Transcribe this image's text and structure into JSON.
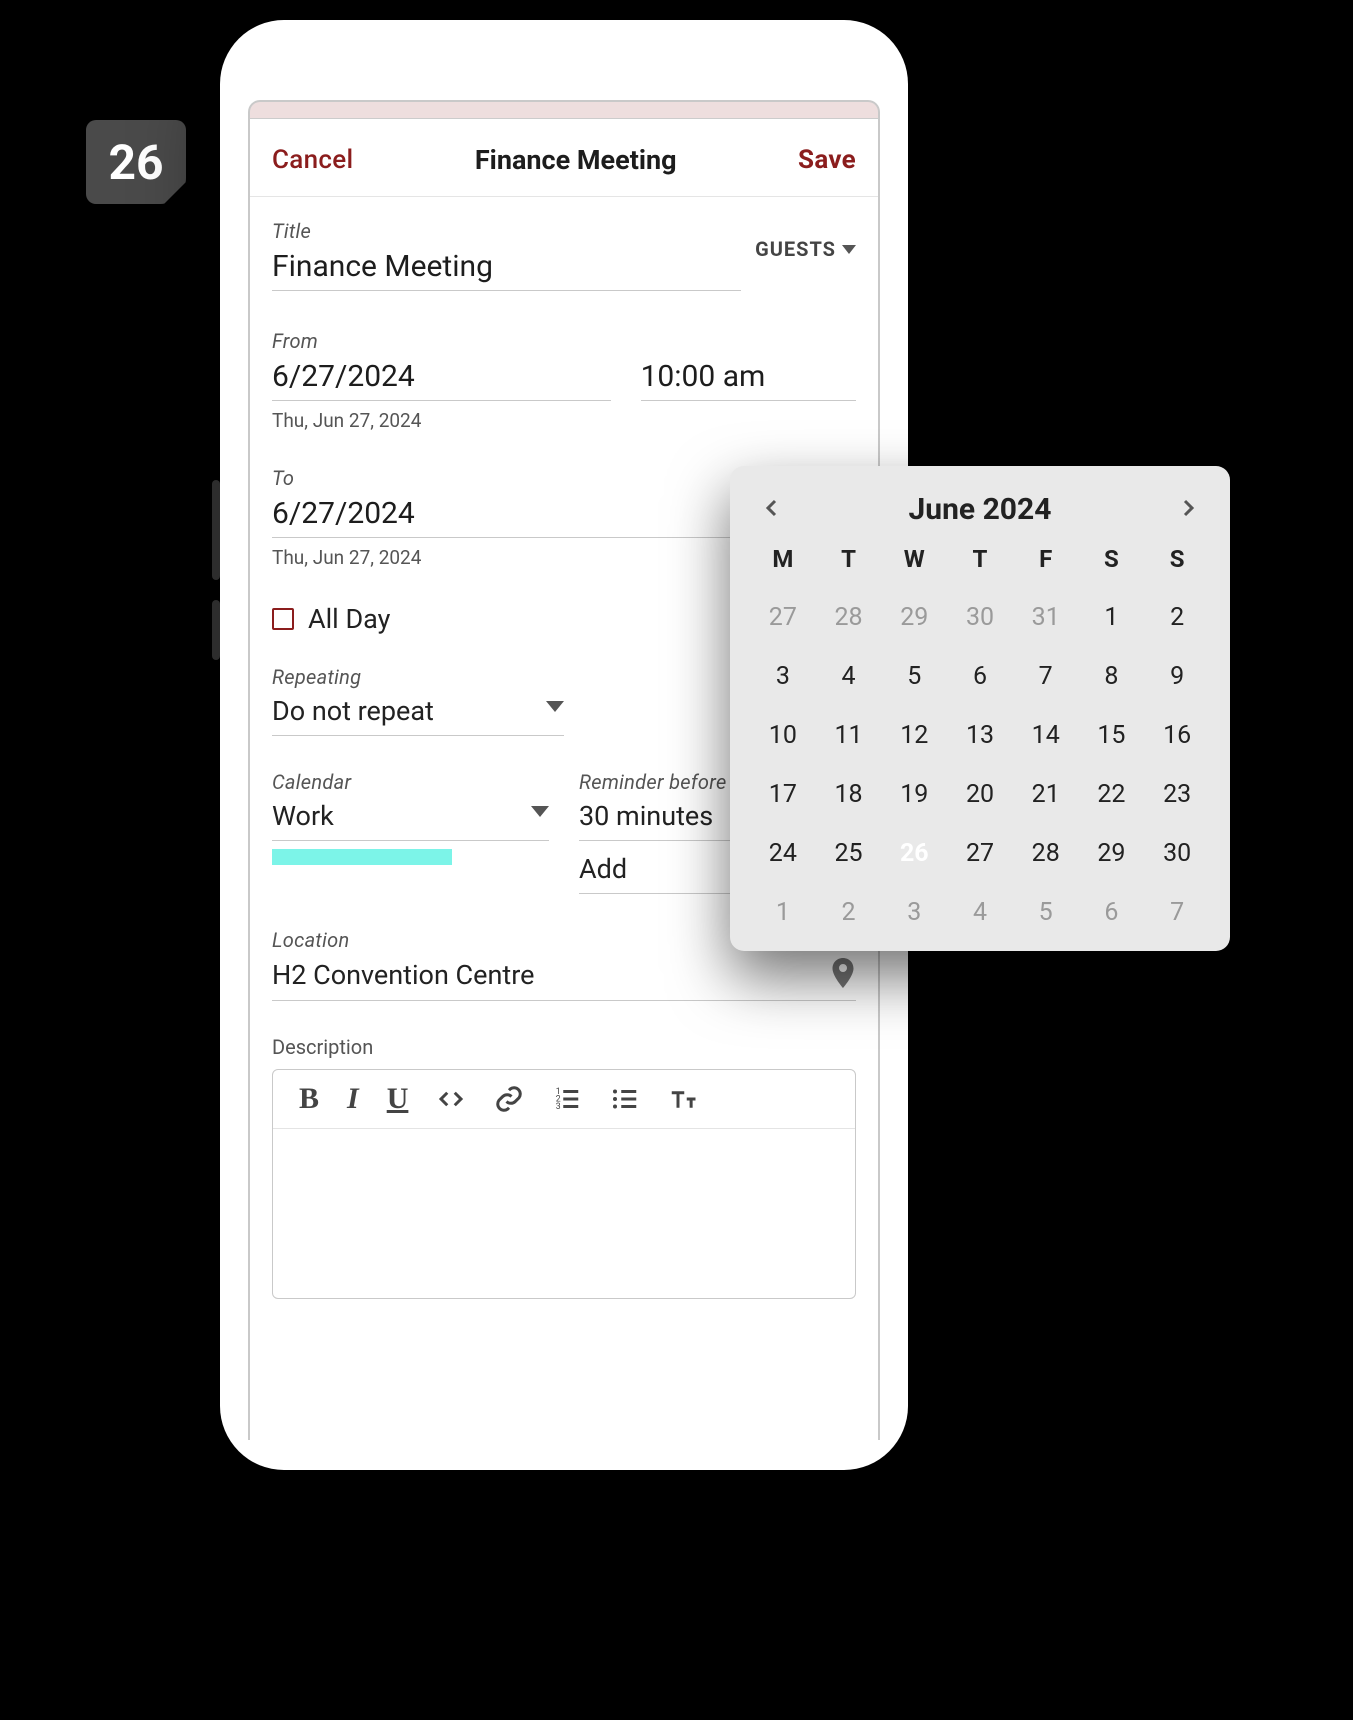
{
  "badge": {
    "day": "26"
  },
  "header": {
    "cancel_label": "Cancel",
    "title": "Finance Meeting",
    "save_label": "Save"
  },
  "event": {
    "title_label": "Title",
    "title_value": "Finance Meeting",
    "guests_label": "GUESTS",
    "from_label": "From",
    "from_date": "6/27/2024",
    "from_time": "10:00 am",
    "from_hint": "Thu, Jun 27, 2024",
    "to_label": "To",
    "to_date": "6/27/2024",
    "to_hint": "Thu, Jun 27, 2024",
    "allday_label": "All Day",
    "allday_checked": false,
    "repeating_label": "Repeating",
    "repeating_value": "Do not repeat",
    "calendar_label": "Calendar",
    "calendar_value": "Work",
    "reminder_label": "Reminder before",
    "reminder_value": "30 minutes",
    "reminder_add": "Add",
    "location_label": "Location",
    "location_value": "H2 Convention Centre",
    "description_label": "Description"
  },
  "calendar_popup": {
    "month_label": "June 2024",
    "dow": [
      "M",
      "T",
      "W",
      "T",
      "F",
      "S",
      "S"
    ],
    "weeks": [
      [
        {
          "d": "27",
          "other": true
        },
        {
          "d": "28",
          "other": true
        },
        {
          "d": "29",
          "other": true
        },
        {
          "d": "30",
          "other": true
        },
        {
          "d": "31",
          "other": true
        },
        {
          "d": "1"
        },
        {
          "d": "2"
        }
      ],
      [
        {
          "d": "3"
        },
        {
          "d": "4"
        },
        {
          "d": "5"
        },
        {
          "d": "6"
        },
        {
          "d": "7"
        },
        {
          "d": "8"
        },
        {
          "d": "9"
        }
      ],
      [
        {
          "d": "10"
        },
        {
          "d": "11"
        },
        {
          "d": "12"
        },
        {
          "d": "13"
        },
        {
          "d": "14"
        },
        {
          "d": "15"
        },
        {
          "d": "16"
        }
      ],
      [
        {
          "d": "17"
        },
        {
          "d": "18"
        },
        {
          "d": "19"
        },
        {
          "d": "20"
        },
        {
          "d": "21"
        },
        {
          "d": "22"
        },
        {
          "d": "23"
        }
      ],
      [
        {
          "d": "24"
        },
        {
          "d": "25"
        },
        {
          "d": "26",
          "selected": true
        },
        {
          "d": "27"
        },
        {
          "d": "28"
        },
        {
          "d": "29"
        },
        {
          "d": "30"
        }
      ],
      [
        {
          "d": "1",
          "other": true
        },
        {
          "d": "2",
          "other": true
        },
        {
          "d": "3",
          "other": true
        },
        {
          "d": "4",
          "other": true
        },
        {
          "d": "5",
          "other": true
        },
        {
          "d": "6",
          "other": true
        },
        {
          "d": "7",
          "other": true
        }
      ]
    ]
  }
}
